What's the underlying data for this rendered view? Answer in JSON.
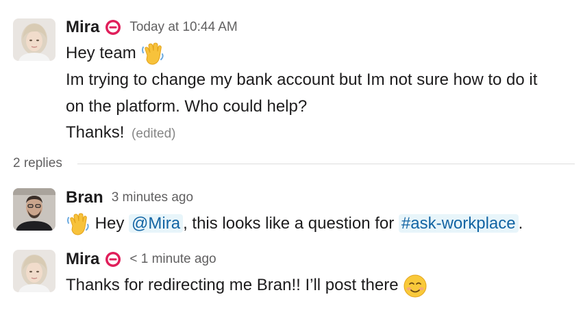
{
  "messages": [
    {
      "author": "Mira",
      "timestamp": "Today at 10:44 AM",
      "status_icon": "do-not-disturb-icon",
      "lines": [
        "Hey team",
        "Im trying to change my bank account but Im not sure how to do it",
        "on the platform. Who could help?",
        "Thanks!"
      ],
      "edited_label": "(edited)",
      "emoji": "waving-hand-icon"
    },
    {
      "author": "Bran",
      "timestamp": "3 minutes ago",
      "text_before": "Hey",
      "mention": "@Mira",
      "text_middle": ", this looks like a question for",
      "channel": "#ask-workplace",
      "text_after": ".",
      "emoji": "waving-hand-icon"
    },
    {
      "author": "Mira",
      "timestamp": "< 1 minute ago",
      "status_icon": "do-not-disturb-icon",
      "text": "Thanks for redirecting me Bran!! I’ll post there",
      "emoji": "smiling-face-icon"
    }
  ],
  "thread": {
    "replies_label": "2 replies"
  },
  "colors": {
    "dnd_red": "#e01e5a",
    "link_blue": "#1264a3",
    "mention_bg": "#e8f5fa",
    "muted_text": "#616061"
  }
}
